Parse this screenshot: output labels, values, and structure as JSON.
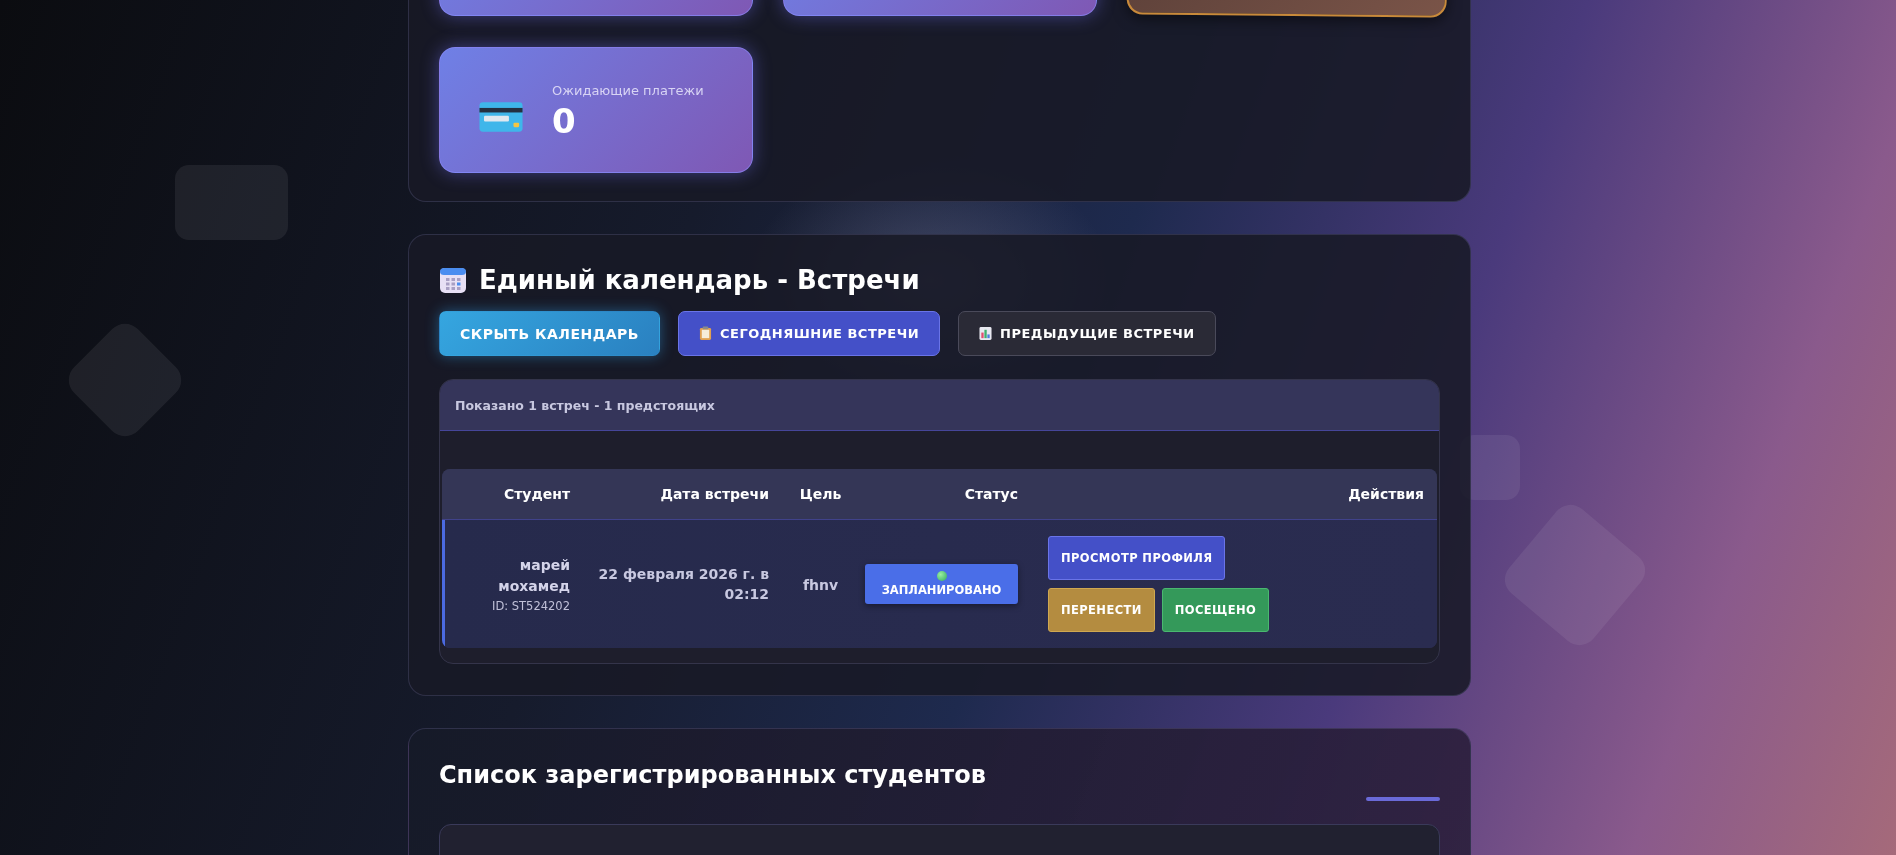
{
  "stat_cards": [
    {
      "kind": "plain"
    },
    {
      "kind": "plain"
    },
    {
      "kind": "highlight"
    },
    {
      "kind": "plain",
      "label": "Ожидающие платежи",
      "value": "0"
    }
  ],
  "calendar": {
    "title": "Единый календарь - Встречи",
    "buttons": [
      {
        "label": "СКРЫТЬ КАЛЕНДАРЬ",
        "kind": "toggle"
      },
      {
        "label": "СЕГОДНЯШНИЕ ВСТРЕЧИ",
        "kind": "today"
      },
      {
        "label": "ПРЕДЫДУЩИЕ ВСТРЕЧИ",
        "kind": "past"
      }
    ],
    "summary": "Показано 1 встреч - 1 предстоящих",
    "columns": [
      "Студент",
      "Дата встречи",
      "Цель",
      "Статус",
      "Действия"
    ],
    "rows": [
      {
        "student": "марей мохамед",
        "student_id": "ID: ST524202",
        "date": "22 февраля 2026 г. в 02:12",
        "purpose": "fhnv",
        "status": "ЗАПЛАНИРОВАНО",
        "actions": [
          {
            "label": "ПРОСМОТР ПРОФИЛЯ",
            "kind": "view"
          },
          {
            "label": "ПЕРЕНЕСТИ",
            "kind": "reschedule"
          },
          {
            "label": "ПОСЕЩЕНО",
            "kind": "attended"
          }
        ]
      }
    ]
  },
  "students": {
    "title": "Список зарегистрированных студентов"
  }
}
